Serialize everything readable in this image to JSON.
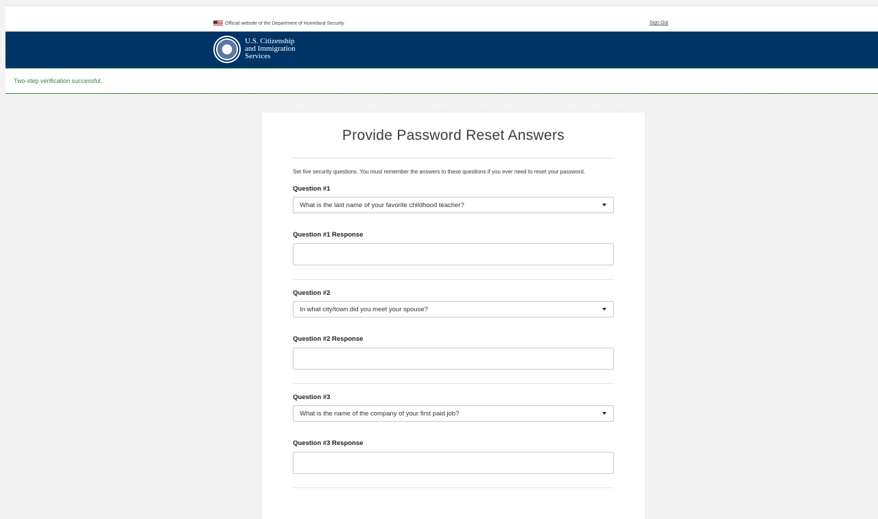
{
  "gov_banner": {
    "official_text": "Official website of the Department of Homeland Security",
    "signout_label": "Sign Out"
  },
  "header": {
    "agency_line1": "U.S. Citizenship",
    "agency_line2": "and Immigration",
    "agency_line3": "Services"
  },
  "alert": {
    "message": "Two-step verification successful."
  },
  "form": {
    "title": "Provide Password Reset Answers",
    "intro": "Set five security questions. You must remember the answers to these questions if you ever need to reset your password.",
    "questions": [
      {
        "label": "Question #1",
        "selected": "What is the last name of your favorite childhood teacher?",
        "response_label": "Question #1 Response",
        "response_value": ""
      },
      {
        "label": "Question #2",
        "selected": "In what city/town did you meet your spouse?",
        "response_label": "Question #2 Response",
        "response_value": ""
      },
      {
        "label": "Question #3",
        "selected": "What is the name of the company of your first paid job?",
        "response_label": "Question #3 Response",
        "response_value": ""
      }
    ]
  },
  "colors": {
    "header_bg": "#003366",
    "success": "#2e8540"
  }
}
